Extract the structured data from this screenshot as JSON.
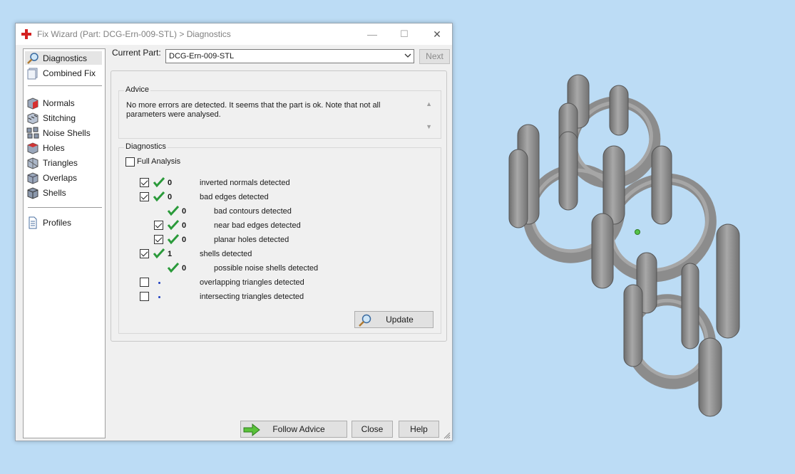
{
  "window": {
    "title": "Fix Wizard (Part: DCG-Ern-009-STL) > Diagnostics",
    "buttons": {
      "minimize": "—",
      "maximize": "☐",
      "close": "✕"
    }
  },
  "sidebar": {
    "items": [
      {
        "label": "Diagnostics",
        "icon": "magnifier-icon",
        "selected": true
      },
      {
        "label": "Combined Fix",
        "icon": "cube-layers-icon"
      },
      {
        "label": "Normals",
        "icon": "normals-cube-icon"
      },
      {
        "label": "Stitching",
        "icon": "stitching-icon"
      },
      {
        "label": "Noise Shells",
        "icon": "noise-shells-icon"
      },
      {
        "label": "Holes",
        "icon": "holes-icon"
      },
      {
        "label": "Triangles",
        "icon": "triangles-icon"
      },
      {
        "label": "Overlaps",
        "icon": "overlaps-icon"
      },
      {
        "label": "Shells",
        "icon": "shells-icon"
      },
      {
        "label": "Profiles",
        "icon": "document-icon"
      }
    ]
  },
  "current_part": {
    "label": "Current Part:",
    "value": "DCG-Ern-009-STL",
    "next_label": "Next"
  },
  "advice": {
    "title": "Advice",
    "text": "No more errors are detected. It seems that the part is ok. Note that not all parameters were analysed."
  },
  "diagnostics": {
    "title": "Diagnostics",
    "full_analysis": {
      "label": "Full Analysis",
      "checked": false
    },
    "rows": [
      {
        "checkbox": true,
        "checked": true,
        "status": "ok",
        "count": "0",
        "label": "inverted normals detected"
      },
      {
        "checkbox": true,
        "checked": true,
        "status": "ok",
        "count": "0",
        "label": "bad edges detected"
      },
      {
        "checkbox": false,
        "checked": false,
        "status": "ok",
        "count": "0",
        "label": "bad contours detected"
      },
      {
        "checkbox": true,
        "checked": true,
        "status": "ok",
        "count": "0",
        "label": "near bad edges detected"
      },
      {
        "checkbox": true,
        "checked": true,
        "status": "ok",
        "count": "0",
        "label": "planar holes detected"
      },
      {
        "checkbox": true,
        "checked": true,
        "status": "ok",
        "count": "1",
        "label": "shells detected"
      },
      {
        "checkbox": false,
        "checked": false,
        "status": "ok",
        "count": "0",
        "label": "possible noise shells detected"
      },
      {
        "checkbox": true,
        "checked": false,
        "status": "pending",
        "count": "",
        "label": "overlapping triangles detected"
      },
      {
        "checkbox": true,
        "checked": false,
        "status": "pending",
        "count": "",
        "label": "intersecting triangles detected"
      }
    ],
    "update_label": "Update"
  },
  "footer": {
    "follow_advice": "Follow Advice",
    "close": "Close",
    "help": "Help"
  },
  "colors": {
    "desktop": "#bcdcf5",
    "check_green": "#2a9a3a",
    "model_gray": "#8c8c8c",
    "title_icon_red": "#d42020"
  }
}
